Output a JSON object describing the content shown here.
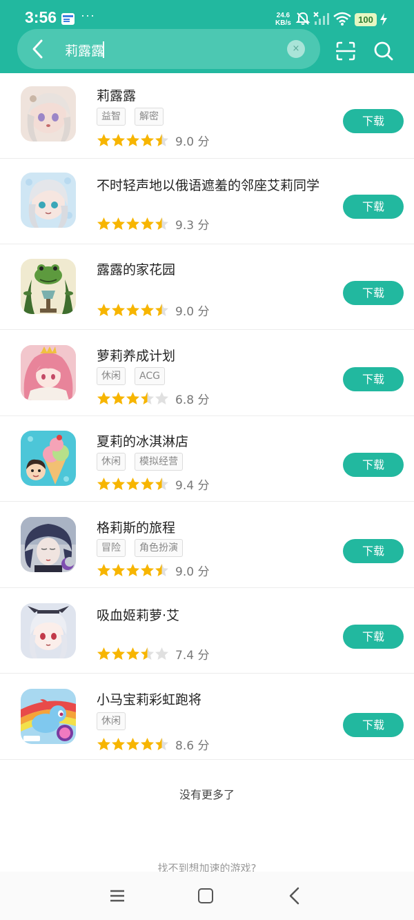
{
  "status_bar": {
    "time": "3:56",
    "more": "···",
    "net_speed_value": "24.6",
    "net_speed_unit": "KB/s",
    "battery": "100"
  },
  "search": {
    "value": "莉露露",
    "clear_symbol": "×"
  },
  "apps": [
    {
      "name": "莉露露",
      "tags": [
        "益智",
        "解密"
      ],
      "score": "9.0 分",
      "stars": 4.5,
      "button": "下载",
      "icon": "anime-girl-white-hair"
    },
    {
      "name": "不时轻声地以俄语遮羞的邻座艾莉同学",
      "tags": [],
      "score": "9.3 分",
      "stars": 4.5,
      "button": "下载",
      "icon": "anime-girl-silver-hair"
    },
    {
      "name": "露露的家花园",
      "tags": [],
      "score": "9.0 分",
      "stars": 4.5,
      "button": "下载",
      "icon": "frog-garden"
    },
    {
      "name": "萝莉养成计划",
      "tags": [
        "休闲",
        "ACG"
      ],
      "score": "6.8 分",
      "stars": 3.5,
      "button": "下载",
      "icon": "anime-girl-pink-hair"
    },
    {
      "name": "夏莉的冰淇淋店",
      "tags": [
        "休闲",
        "模拟经营"
      ],
      "score": "9.4 分",
      "stars": 4.5,
      "button": "下载",
      "icon": "ice-cream"
    },
    {
      "name": "格莉斯的旅程",
      "tags": [
        "冒险",
        "角色扮演"
      ],
      "score": "9.0 分",
      "stars": 4.5,
      "button": "下载",
      "icon": "gris-girl"
    },
    {
      "name": "吸血姬莉萝·艾",
      "tags": [],
      "score": "7.4 分",
      "stars": 3.5,
      "button": "下载",
      "icon": "vampire-girl"
    },
    {
      "name": "小马宝莉彩虹跑将",
      "tags": [
        "休闲"
      ],
      "score": "8.6 分",
      "stars": 4.5,
      "button": "下载",
      "icon": "rainbow-pony"
    }
  ],
  "footer": {
    "no_more": "没有更多了",
    "cant_find": "找不到想加速的游戏?"
  },
  "colors": {
    "accent": "#22b89f",
    "star": "#f7b500",
    "star_empty": "#e0e0e0"
  }
}
